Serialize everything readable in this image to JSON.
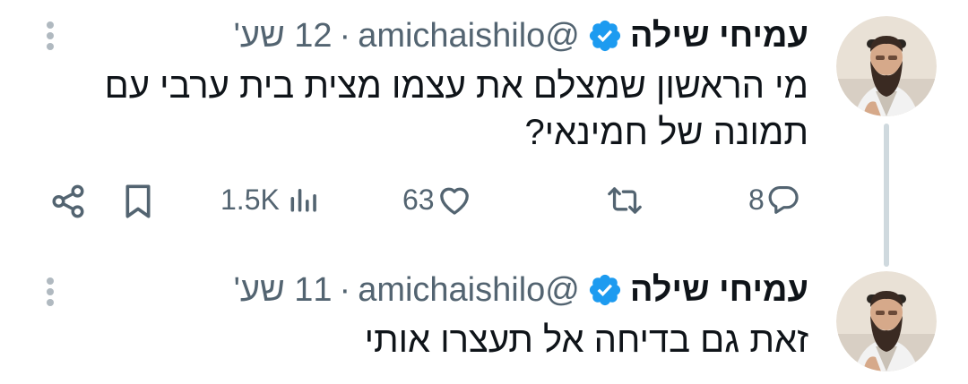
{
  "tweets": [
    {
      "author_name": "עמיחי שילה",
      "handle": "@amichaishilo",
      "separator": "·",
      "time": "12 שע'",
      "text_lines": [
        "מי הראשון שמצלם את עצמו מצית בית ערבי עם",
        "תמונה של חמינאי?"
      ],
      "replies": "8",
      "likes": "63",
      "views": "1.5K"
    },
    {
      "author_name": "עמיחי שילה",
      "handle": "@amichaishilo",
      "separator": "·",
      "time": "11 שע'",
      "text_lines": [
        "זאת גם בדיחה אל תעצרו אותי"
      ]
    }
  ],
  "icons": {
    "reply": "speech-bubble-icon",
    "retweet": "retweet-icon",
    "like": "heart-icon",
    "views": "bar-chart-icon",
    "bookmark": "bookmark-icon",
    "share": "share-icon",
    "verified": "verified-badge-icon",
    "more": "vertical-dots-icon"
  },
  "colors": {
    "text": "#0f1419",
    "secondary": "#536471",
    "verified": "#1d9bf0",
    "thread_line": "#cfd9de"
  }
}
